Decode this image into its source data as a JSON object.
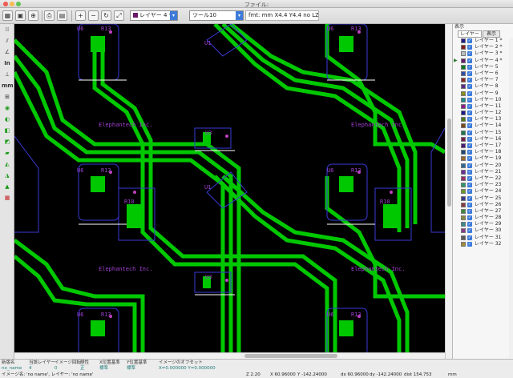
{
  "window": {
    "title": "ファイル:"
  },
  "toolbar": {
    "layer_combo": "レイヤー 4 *",
    "tool_combo": "ツール10",
    "fmt_text": "fmt: mm X4.4 Y4.4 no LZ",
    "icons": [
      "grid-icon",
      "grid-icon",
      "zoom-icon",
      "print-icon",
      "zoom-in-icon",
      "zoom-out-icon",
      "redraw-icon",
      "zoom-fit-icon"
    ]
  },
  "lefttools": {
    "labels": [
      "",
      "",
      "",
      "In",
      "mm",
      "",
      "",
      "",
      "",
      "",
      "",
      "",
      "",
      "",
      ""
    ]
  },
  "board": {
    "company": "Elephantech Inc.",
    "u6": "U6",
    "r13": "R13",
    "u3": "U3",
    "u1": "U1",
    "r10": "R10"
  },
  "panel": {
    "heading": "表示",
    "tab_layer": "レイヤー",
    "tab_display": "表示",
    "layers": [
      {
        "label": "レイヤー 1 *",
        "color": "#1e1e8c",
        "mark": ""
      },
      {
        "label": "レイヤー 2 *",
        "color": "#8a1a1a",
        "mark": ""
      },
      {
        "label": "レイヤー 3 *",
        "color": "#bdbdbd",
        "mark": ""
      },
      {
        "label": "レイヤー 4 *",
        "color": "#6b1a6b",
        "mark": "▶"
      },
      {
        "label": "レイヤー 5",
        "color": "#0b7a1e",
        "mark": ""
      },
      {
        "label": "レイヤー 6",
        "color": "#2f4fa8",
        "mark": ""
      },
      {
        "label": "レイヤー 7",
        "color": "#8c2a2a",
        "mark": ""
      },
      {
        "label": "レイヤー 8",
        "color": "#5a2a8c",
        "mark": ""
      },
      {
        "label": "レイヤー 9",
        "color": "#8c8c1a",
        "mark": ""
      },
      {
        "label": "レイヤー 10",
        "color": "#1a8c8c",
        "mark": ""
      },
      {
        "label": "レイヤー 11",
        "color": "#8c1a8c",
        "mark": ""
      },
      {
        "label": "レイヤー 12",
        "color": "#1a1a8c",
        "mark": ""
      },
      {
        "label": "レイヤー 13",
        "color": "#4a7a1a",
        "mark": ""
      },
      {
        "label": "レイヤー 14",
        "color": "#7a4a1a",
        "mark": ""
      },
      {
        "label": "レイヤー 15",
        "color": "#1a7a4a",
        "mark": ""
      },
      {
        "label": "レイヤー 16",
        "color": "#7a1a4a",
        "mark": ""
      },
      {
        "label": "レイヤー 17",
        "color": "#4a1a7a",
        "mark": ""
      },
      {
        "label": "レイヤー 18",
        "color": "#1a4a7a",
        "mark": ""
      },
      {
        "label": "レイヤー 19",
        "color": "#9a6a2a",
        "mark": ""
      },
      {
        "label": "レイヤー 20",
        "color": "#2a6a9a",
        "mark": ""
      },
      {
        "label": "レイヤー 21",
        "color": "#6a2a9a",
        "mark": ""
      },
      {
        "label": "レイヤー 22",
        "color": "#9a2a6a",
        "mark": ""
      },
      {
        "label": "レイヤー 23",
        "color": "#2a9a6a",
        "mark": ""
      },
      {
        "label": "レイヤー 24",
        "color": "#6a9a2a",
        "mark": ""
      },
      {
        "label": "レイヤー 25",
        "color": "#3a3a8a",
        "mark": ""
      },
      {
        "label": "レイヤー 26",
        "color": "#8a3a3a",
        "mark": ""
      },
      {
        "label": "レイヤー 27",
        "color": "#3a8a3a",
        "mark": ""
      },
      {
        "label": "レイヤー 28",
        "color": "#8a8a3a",
        "mark": ""
      },
      {
        "label": "レイヤー 29",
        "color": "#3a8a8a",
        "mark": ""
      },
      {
        "label": "レイヤー 30",
        "color": "#8a3a8a",
        "mark": ""
      },
      {
        "label": "レイヤー 31",
        "color": "#5a5a5a",
        "mark": ""
      },
      {
        "label": "レイヤー 32",
        "color": "#a08a3a",
        "mark": ""
      }
    ]
  },
  "status": {
    "row1": [
      {
        "head": "新版名",
        "value": "no_name"
      },
      {
        "head": "当該レイヤー",
        "value": "4"
      },
      {
        "head": "イメージ回転",
        "value": "0"
      },
      {
        "head": "極性",
        "value": "正"
      },
      {
        "head": "X位置基準",
        "value": "標準"
      },
      {
        "head": "Y位置基準",
        "value": "標準"
      },
      {
        "head": "イメージのオフセット",
        "value": "X=0.000000 Y=0.000000"
      }
    ],
    "image_info": "イメージ名: 'no name', レイヤー: 'no name'",
    "zoom": "Z 2.20",
    "x": "X 60.96000",
    "y": "Y -142.24000",
    "dx": "dx 60.96000",
    "dy": "dy -142.24000",
    "dist": "dist 154.753",
    "unit": "mm"
  }
}
